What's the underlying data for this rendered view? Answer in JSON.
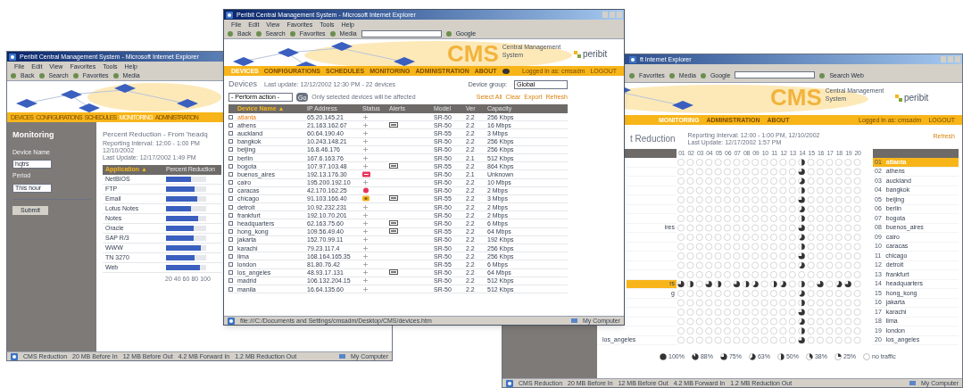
{
  "left_window": {
    "title": "Peribit Central Management System - Microsoft Internet Explorer",
    "menu": [
      "File",
      "Edit",
      "View",
      "Favorites",
      "Tools",
      "Help"
    ],
    "toolbar": [
      "Back",
      "Search",
      "Favorites",
      "Media"
    ],
    "nav": [
      {
        "label": "DEVICES",
        "selected": false
      },
      {
        "label": "CONFIGURATIONS",
        "selected": false
      },
      {
        "label": "SCHEDULES",
        "selected": false
      },
      {
        "label": "MONITORING",
        "selected": true
      },
      {
        "label": "ADMINISTRATION",
        "selected": false
      }
    ],
    "sidebar": {
      "heading": "Monitoring",
      "fields": [
        {
          "label": "Device Name",
          "value": "hqtrs"
        },
        {
          "label": "Period",
          "value": "This hour"
        }
      ],
      "button": "Submit"
    },
    "heading": "Percent Reduction - From 'headq",
    "subtitle": [
      "Reporting Interval: 12:00 - 1:00 PM 12/10/2002",
      "Last Update: 12/17/2002 1:49 PM"
    ],
    "columns": [
      "Application ▲",
      "Percent Reduction"
    ],
    "rows": [
      {
        "name": "NetBIOS",
        "level": 0.62
      },
      {
        "name": "FTP",
        "level": 0.7
      },
      {
        "name": "Email",
        "level": 0.78
      },
      {
        "name": "Lotus Notes",
        "level": 0.62
      },
      {
        "name": "Notes",
        "level": 0.8
      },
      {
        "name": "Oracle",
        "level": 0.68
      },
      {
        "name": "SAP R/3",
        "level": 0.68
      },
      {
        "name": "WWW",
        "level": 0.86
      },
      {
        "name": "TN 3270",
        "level": 0.72
      },
      {
        "name": "Web",
        "level": 0.84
      }
    ],
    "ticks": [
      "20",
      "40",
      "60",
      "80",
      "100"
    ],
    "status_bar": [
      "CMS Reduction",
      "20 MB Before In",
      "12 MB Before Out",
      "4.2 MB Forward In",
      "1.2 MB Reduction Out",
      "My Computer"
    ]
  },
  "center_window": {
    "title": "Peribit Central Management System - Microsoft Internet Explorer",
    "menu": [
      "File",
      "Edit",
      "View",
      "Favorites",
      "Tools",
      "Help"
    ],
    "toolbar": [
      "Back",
      "Search",
      "Favorites",
      "Media",
      "Google"
    ],
    "banner": {
      "product": "CMS",
      "subtitle": "Central Management System",
      "logo": "peribit"
    },
    "nav": [
      {
        "label": "DEVICES",
        "selected": true
      },
      {
        "label": "CONFIGURATIONS",
        "selected": false
      },
      {
        "label": "SCHEDULES",
        "selected": false
      },
      {
        "label": "MONITORING",
        "selected": false
      },
      {
        "label": "ADMINISTRATION",
        "selected": false
      },
      {
        "label": "ABOUT",
        "selected": false
      }
    ],
    "user": "Logged in as: cmsadm",
    "logout": "LOGOUT",
    "heading": "Devices",
    "last_update": "Last update: 12/12/2002 12:30 PM - 22 devices",
    "group_label": "Device group:",
    "group_value": "Global",
    "action": "- Perform action -",
    "go": "Go",
    "action_hint": "Only selected devices will be affected",
    "links": [
      "Select All",
      "Clear",
      "Export",
      "Refresh"
    ],
    "columns": [
      "Device Name ▲",
      "IP Address",
      "Status",
      "Alerts",
      "Model",
      "Ver",
      "Capacity"
    ],
    "rows": [
      {
        "name": "atlanta",
        "ip": "65.20.145.21",
        "status": {
          "kind": "ok"
        },
        "alert": false,
        "model": "SR-50",
        "ver": "2.2",
        "capacity": "256 Kbps",
        "checked": false,
        "selected": true
      },
      {
        "name": "athens",
        "ip": "21.163.162.67",
        "status": {
          "kind": "ok"
        },
        "alert": true,
        "model": "SR-50",
        "ver": "2.2",
        "capacity": "16 Mbps",
        "checked": false,
        "selected": false
      },
      {
        "name": "auckland",
        "ip": "60.64.190.40",
        "status": {
          "kind": "ok"
        },
        "alert": false,
        "model": "SR-55",
        "ver": "2.2",
        "capacity": "3 Mbps",
        "checked": false,
        "selected": false
      },
      {
        "name": "bangkok",
        "ip": "10.243.148.21",
        "status": {
          "kind": "ok"
        },
        "alert": false,
        "model": "SR-50",
        "ver": "2.2",
        "capacity": "256 Kbps",
        "checked": false,
        "selected": false
      },
      {
        "name": "beijing",
        "ip": "16.8.46.176",
        "status": {
          "kind": "ok"
        },
        "alert": false,
        "model": "SR-50",
        "ver": "2.2",
        "capacity": "256 Kbps",
        "checked": false,
        "selected": false
      },
      {
        "name": "berlin",
        "ip": "167.6.163.76",
        "status": {
          "kind": "ok"
        },
        "alert": false,
        "model": "SR-50",
        "ver": "2.1",
        "capacity": "512 Kbps",
        "checked": false,
        "selected": false
      },
      {
        "name": "bogota",
        "ip": "107.97.103.48",
        "status": {
          "kind": "ok"
        },
        "alert": true,
        "model": "SR-55",
        "ver": "2.2",
        "capacity": "864 Kbps",
        "checked": false,
        "selected": false
      },
      {
        "name": "buenos_aires",
        "ip": "192.13.176.30",
        "status": {
          "kind": "down"
        },
        "alert": false,
        "model": "SR-50",
        "ver": "2.1",
        "capacity": "Unknown",
        "checked": false,
        "selected": false
      },
      {
        "name": "cairo",
        "ip": "195.200.192.10",
        "status": {
          "kind": "ok"
        },
        "alert": false,
        "model": "SR-50",
        "ver": "2.2",
        "capacity": "10 Mbps",
        "checked": false,
        "selected": false
      },
      {
        "name": "caracas",
        "ip": "42.170.162.25",
        "status": {
          "kind": "alarm"
        },
        "alert": false,
        "model": "SR-50",
        "ver": "2.2",
        "capacity": "2 Mbps",
        "checked": false,
        "selected": false
      },
      {
        "name": "chicago",
        "ip": "91.103.166.40",
        "status": {
          "kind": "warning"
        },
        "alert": true,
        "model": "SR-55",
        "ver": "2.2",
        "capacity": "3 Mbps",
        "checked": false,
        "selected": false
      },
      {
        "name": "detroit",
        "ip": "10.92.232.231",
        "status": {
          "kind": "ok"
        },
        "alert": false,
        "model": "SR-50",
        "ver": "2.2",
        "capacity": "2 Mbps",
        "checked": false,
        "selected": false
      },
      {
        "name": "frankfurt",
        "ip": "192.10.70.201",
        "status": {
          "kind": "ok"
        },
        "alert": false,
        "model": "SR-50",
        "ver": "2.2",
        "capacity": "2 Mbps",
        "checked": false,
        "selected": false
      },
      {
        "name": "headquarters",
        "ip": "62.163.75.60",
        "status": {
          "kind": "ok"
        },
        "alert": true,
        "model": "SR-50",
        "ver": "2.2",
        "capacity": "6 Mbps",
        "checked": false,
        "selected": false
      },
      {
        "name": "hong_kong",
        "ip": "109.56.49.40",
        "status": {
          "kind": "ok"
        },
        "alert": true,
        "model": "SR-55",
        "ver": "2.2",
        "capacity": "64 Mbps",
        "checked": false,
        "selected": false
      },
      {
        "name": "jakarta",
        "ip": "152.70.99.11",
        "status": {
          "kind": "ok"
        },
        "alert": false,
        "model": "SR-50",
        "ver": "2.2",
        "capacity": "192 Kbps",
        "checked": false,
        "selected": false
      },
      {
        "name": "karachi",
        "ip": "79.23.117.4",
        "status": {
          "kind": "ok"
        },
        "alert": false,
        "model": "SR-50",
        "ver": "2.2",
        "capacity": "256 Kbps",
        "checked": false,
        "selected": false
      },
      {
        "name": "lima",
        "ip": "168.164.165.35",
        "status": {
          "kind": "ok"
        },
        "alert": false,
        "model": "SR-50",
        "ver": "2.2",
        "capacity": "256 Kbps",
        "checked": false,
        "selected": false
      },
      {
        "name": "london",
        "ip": "81.80.76.42",
        "status": {
          "kind": "ok"
        },
        "alert": false,
        "model": "SR-55",
        "ver": "2.2",
        "capacity": "6 Mbps",
        "checked": false,
        "selected": false
      },
      {
        "name": "los_angeles",
        "ip": "48.93.17.131",
        "status": {
          "kind": "ok"
        },
        "alert": true,
        "model": "SR-50",
        "ver": "2.2",
        "capacity": "64 Mbps",
        "checked": false,
        "selected": false
      },
      {
        "name": "madrid",
        "ip": "106.132.204.15",
        "status": {
          "kind": "ok"
        },
        "alert": false,
        "model": "SR-50",
        "ver": "2.2",
        "capacity": "512 Kbps",
        "checked": false,
        "selected": false
      },
      {
        "name": "manila",
        "ip": "16.64.135.60",
        "status": {
          "kind": "ok"
        },
        "alert": false,
        "model": "SR-50",
        "ver": "2.2",
        "capacity": "512 Kbps",
        "checked": false,
        "selected": false
      }
    ],
    "status_bar": [
      "file:///C:/Documents and Settings/cmsadm/Desktop/CMS/devices.htm",
      "My Computer"
    ]
  },
  "right_window": {
    "title": "ft Internet Explorer",
    "toolbar": [
      "Favorites",
      "Media",
      "Google",
      "Search Web"
    ],
    "banner": {
      "product": "CMS",
      "subtitle": "Central Management System",
      "logo": "peribit"
    },
    "nav": [
      {
        "label": "MONITORING",
        "selected": true
      },
      {
        "label": "ADMINISTRATION",
        "selected": false
      },
      {
        "label": "ABOUT",
        "selected": false
      }
    ],
    "user": "Logged in as: cmsadm",
    "logout": "LOGOUT",
    "heading": "t Reduction",
    "subtitle": [
      "Reporting Interval: 12:00 - 1:00 PM, 12/10/2002",
      "Last Update: 12/17/2002 1:57 PM"
    ],
    "refresh": "Refresh",
    "hours": [
      "01",
      "02",
      "03",
      "04",
      "05",
      "06",
      "07",
      "08",
      "09",
      "10",
      "11",
      "12",
      "13",
      "14",
      "15",
      "16",
      "17",
      "18",
      "19",
      "20"
    ],
    "left_rows": [
      {
        "selected": false
      },
      {
        "selected": false
      },
      {
        "selected": false
      },
      {
        "selected": false
      },
      {
        "selected": false
      },
      {
        "selected": false
      },
      {
        "selected": false
      },
      {
        "label": "ires",
        "selected": false
      },
      {
        "selected": false
      },
      {
        "selected": false
      },
      {
        "selected": false
      },
      {
        "selected": false
      },
      {
        "selected": false
      },
      {
        "label": "rs",
        "selected": true
      },
      {
        "label": "g",
        "selected": false
      },
      {
        "selected": false
      },
      {
        "selected": false
      },
      {
        "selected": false
      },
      {
        "selected": false
      },
      {
        "label": "los_angeles",
        "selected": false
      }
    ],
    "devices": [
      {
        "index": "01",
        "name": "atlanta",
        "selected": true
      },
      {
        "index": "02",
        "name": "athens",
        "selected": false
      },
      {
        "index": "03",
        "name": "auckland",
        "selected": false
      },
      {
        "index": "04",
        "name": "bangkok",
        "selected": false
      },
      {
        "index": "05",
        "name": "beijing",
        "selected": false
      },
      {
        "index": "06",
        "name": "berlin",
        "selected": false
      },
      {
        "index": "07",
        "name": "bogota",
        "selected": false
      },
      {
        "index": "08",
        "name": "buenos_aires",
        "selected": false
      },
      {
        "index": "09",
        "name": "cairo",
        "selected": false
      },
      {
        "index": "10",
        "name": "caracas",
        "selected": false
      },
      {
        "index": "11",
        "name": "chicago",
        "selected": false
      },
      {
        "index": "12",
        "name": "detroit",
        "selected": false
      },
      {
        "index": "13",
        "name": "frankfurt",
        "selected": false
      },
      {
        "index": "14",
        "name": "headquarters",
        "selected": false
      },
      {
        "index": "15",
        "name": "hong_kong",
        "selected": false
      },
      {
        "index": "16",
        "name": "jakarta",
        "selected": false
      },
      {
        "index": "17",
        "name": "karachi",
        "selected": false
      },
      {
        "index": "18",
        "name": "lima",
        "selected": false
      },
      {
        "index": "19",
        "name": "london",
        "selected": false
      },
      {
        "index": "20",
        "name": "los_angeles",
        "selected": false
      }
    ],
    "legend": [
      {
        "label": "100%",
        "kind": "full"
      },
      {
        "label": "88%",
        "kind": "seven_eighths"
      },
      {
        "label": "75%",
        "kind": "three_quarters"
      },
      {
        "label": "63%",
        "kind": "five_eighths"
      },
      {
        "label": "50%",
        "kind": "half"
      },
      {
        "label": "38%",
        "kind": "three_eighths"
      },
      {
        "label": "25%",
        "kind": "quarter"
      },
      {
        "label": "no traffic",
        "kind": "empty"
      }
    ],
    "status_bar": [
      "CMS Reduction",
      "20 MB Before In",
      "12 MB Before Out",
      "4.2 MB Forward In",
      "1.2 MB Reduction Out",
      "My Computer"
    ]
  }
}
